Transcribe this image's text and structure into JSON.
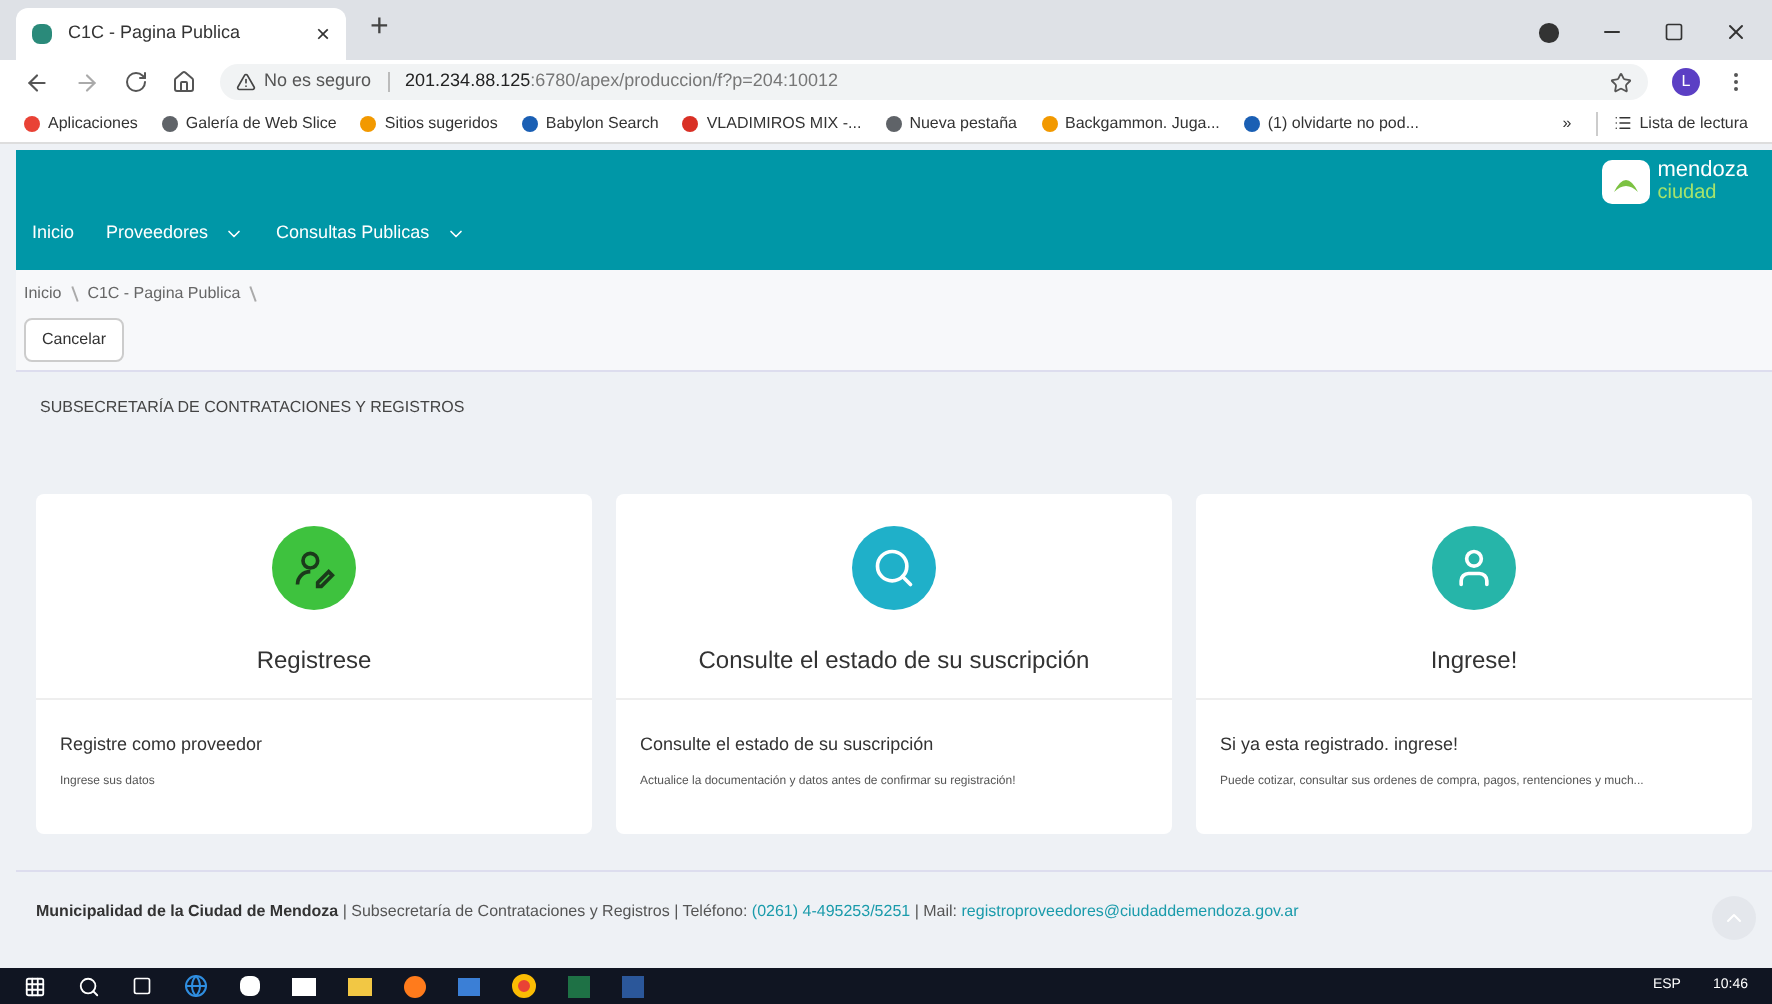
{
  "browser": {
    "tab_title": "C1C - Pagina Publica",
    "close": "×",
    "new_tab": "+",
    "security": "No es seguro",
    "url_host": "201.234.88.125",
    "url_path": ":6780/apex/produccion/f?p=204:10012",
    "profile": "L",
    "bookmarks": [
      {
        "label": "Aplicaciones",
        "color": "#e94235"
      },
      {
        "label": "Galería de Web Slice",
        "color": "#5f6368"
      },
      {
        "label": "Sitios sugeridos",
        "color": "#f29900"
      },
      {
        "label": "Babylon Search",
        "color": "#1a5fb4"
      },
      {
        "label": "VLADIMIROS MIX -...",
        "color": "#d93025"
      },
      {
        "label": "Nueva pestaña",
        "color": "#5f6368"
      },
      {
        "label": "Backgammon. Juga...",
        "color": "#f29900"
      },
      {
        "label": "(1) olvidarte no pod...",
        "color": "#1a5fb4"
      }
    ],
    "more": "»",
    "reading_list": "Lista de lectura"
  },
  "header": {
    "logo_line1": "mendoza",
    "logo_line2": "ciudad",
    "nav": [
      {
        "label": "Inicio",
        "dropdown": false
      },
      {
        "label": "Proveedores",
        "dropdown": true
      },
      {
        "label": "Consultas Publicas",
        "dropdown": true
      }
    ]
  },
  "breadcrumb": [
    "Inicio",
    "C1C - Pagina Publica"
  ],
  "cancel_button": "Cancelar",
  "section_title": "SUBSECRETARÍA DE CONTRATACIONES Y REGISTROS",
  "cards": [
    {
      "kind": "register",
      "color": "#3ec23e",
      "title": "Registrese",
      "subtitle": "Registre como proveedor",
      "description": "Ingrese sus datos"
    },
    {
      "kind": "search",
      "color": "#1fb0c9",
      "title": "Consulte el estado de su suscripción",
      "subtitle": "Consulte el estado de su suscripción",
      "description": "Actualice la documentación y datos antes de confirmar su registración!"
    },
    {
      "kind": "user",
      "color": "#26b5a9",
      "title": "Ingrese!",
      "subtitle": "Si ya esta registrado. ingrese!",
      "description": "Puede cotizar, consultar sus ordenes de compra, pagos, rentenciones y much..."
    }
  ],
  "footer": {
    "org": "Municipalidad de la Ciudad de Mendoza",
    "text": " | Subsecretaría de Contrataciones y Registros | Teléfono: ",
    "phone": "(0261) 4-495253/5251",
    "mail_label": " | Mail: ",
    "mail": "registroproveedores@ciudaddemendoza.gov.ar"
  },
  "taskbar": {
    "language": "ESP",
    "time": "10:46"
  }
}
